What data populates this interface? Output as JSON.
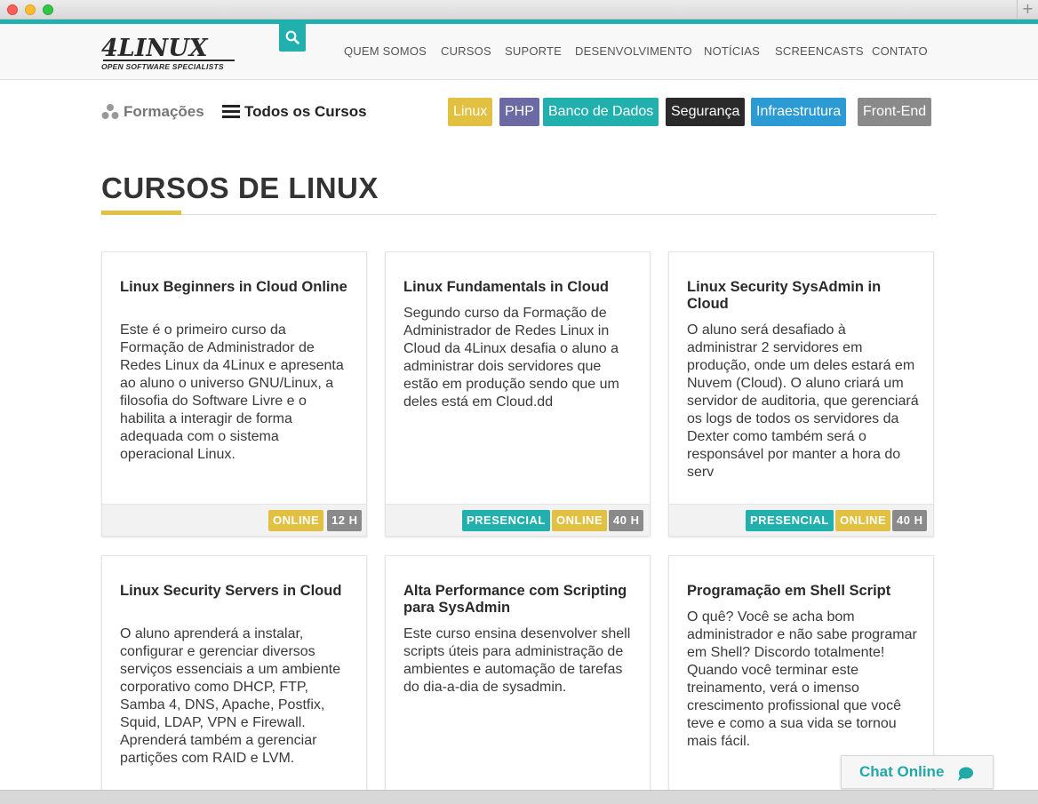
{
  "header": {
    "logo_text": "4LINUX",
    "logo_tagline": "OPEN SOFTWARE SPECIALISTS",
    "nav": [
      "QUEM SOMOS",
      "CURSOS",
      "SUPORTE",
      "DESENVOLVIMENTO",
      "NOTÍCIAS",
      "SCREENCASTS",
      "CONTATO"
    ]
  },
  "filters": {
    "formacoes_label": "Formações",
    "todos_label": "Todos os Cursos",
    "categories": [
      {
        "label": "Linux",
        "color": "#e2c042"
      },
      {
        "label": "PHP",
        "color": "#6b6aa5"
      },
      {
        "label": "Banco de Dados",
        "color": "#22b0ae"
      },
      {
        "label": "Segurança",
        "color": "#2a2a2a"
      },
      {
        "label": "Infraestrutura",
        "color": "#2d9bd3"
      },
      {
        "label": "Front-End",
        "color": "#8a8a8a"
      }
    ]
  },
  "page_title": "CURSOS DE LINUX",
  "courses": [
    {
      "title": "Linux Beginners in Cloud Online",
      "description": "Este é o primeiro curso da Formação de Administrador de Redes Linux da 4Linux e apresenta ao aluno o universo GNU/Linux, a filosofia do Software Livre e o habilita a interagir de forma adequada com o sistema operacional Linux.",
      "badges": {
        "online": "ONLINE",
        "hours": "12 H"
      }
    },
    {
      "title": "Linux Fundamentals in Cloud",
      "description": "Segundo curso da Formação de Administrador de Redes Linux in Cloud da 4Linux desafia o aluno a administrar dois servidores que estão em produção sendo que um deles está em Cloud.dd",
      "badges": {
        "presencial": "PRESENCIAL",
        "online": "ONLINE",
        "hours": "40 H"
      }
    },
    {
      "title": "Linux Security SysAdmin in Cloud",
      "description": "O aluno será desafiado à administrar 2 servidores em produção, onde um deles estará em Nuvem (Cloud). O aluno criará um servidor de auditoria, que gerenciará os logs de todos os servidores da Dexter como também será o responsável por manter a hora do serv",
      "badges": {
        "presencial": "PRESENCIAL",
        "online": "ONLINE",
        "hours": "40 H"
      }
    },
    {
      "title": "Linux Security Servers in Cloud",
      "description": "O aluno aprenderá a instalar, configurar e gerenciar diversos serviços essenciais a um ambiente corporativo como DHCP, FTP, Samba 4, DNS, Apache, Postfix, Squid, LDAP, VPN e Firewall. Aprenderá também a gerenciar partições com RAID e LVM."
    },
    {
      "title": "Alta Performance com Scripting para SysAdmin",
      "description": "Este curso ensina desenvolver shell scripts úteis para administração de ambientes e automação de tarefas do dia-a-dia de sysadmin."
    },
    {
      "title": "Programação em Shell Script",
      "description": "O quê? Você se acha bom administrador e não sabe programar em Shell? Discordo totalmente! Quando você terminar este treinamento, verá o imenso crescimento profissional que você teve e como a sua vida se tornou mais fácil."
    }
  ],
  "chat_label": "Chat Online",
  "colors": {
    "teal": "#22b0ae",
    "yellow": "#e2c042",
    "gray": "#8a8a8a"
  }
}
